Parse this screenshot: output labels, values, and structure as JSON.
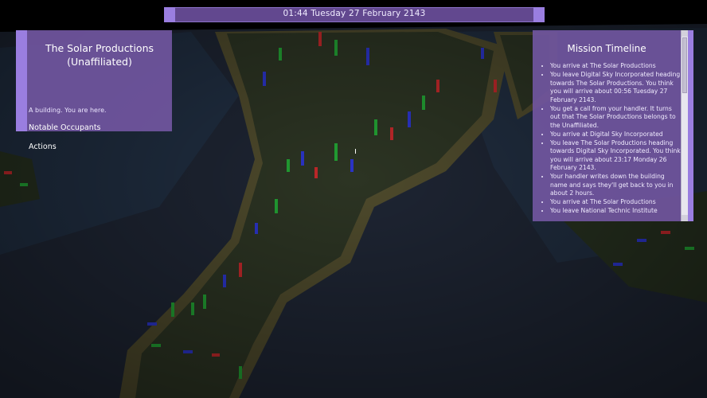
{
  "clock": {
    "text": "01:44 Tuesday 27 February 2143"
  },
  "location": {
    "title": "The Solar Productions (Unaffiliated)",
    "description": "A building. You are here.",
    "sections": {
      "occupants": "Notable Occupants",
      "actions": "Actions"
    }
  },
  "timeline": {
    "title": "Mission Timeline",
    "entries": [
      "You arrive at The Solar Productions",
      "You leave Digital Sky Incorporated heading towards The Solar Productions. You think you will arrive about 00:56 Tuesday 27 February 2143.",
      "You get a call from your handler. It turns out that The Solar Productions belongs to the Unaffiliated.",
      "You arrive at Digital Sky Incorporated",
      "You leave The Solar Productions heading towards Digital Sky Incorporated. You think you will arrive about 23:17 Monday 26 February 2143.",
      "Your handler writes down the building name and says they'll get back to you in about 2 hours.",
      "You arrive at The Solar Productions",
      "You leave National Technic Institute"
    ]
  },
  "colors": {
    "panel": "#7156a0",
    "accent": "#9a7ee0",
    "clock_bar": "#62488f",
    "map_water": "#1f2a3a",
    "map_land": "#2e3a24",
    "map_beach": "#5b5432",
    "building_red": "#c0282a",
    "building_green": "#22a033",
    "building_blue": "#2b34c8"
  }
}
